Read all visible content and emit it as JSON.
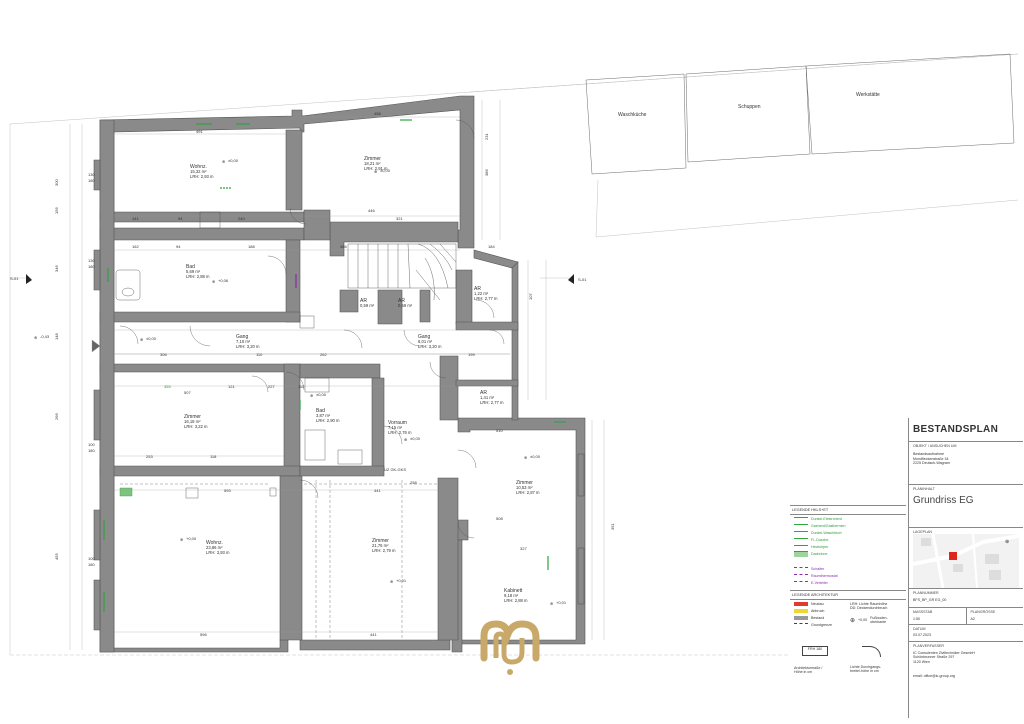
{
  "rooms": [
    {
      "name": "Wohnz.",
      "area": "15,32 m²",
      "lrh": "LRH: 2,93 m"
    },
    {
      "name": "Zimmer",
      "area": "18,21 m²",
      "lrh": "LRH: 2,91 m"
    },
    {
      "name": "Bad",
      "area": "5,69 m²",
      "lrh": "LRH: 2,88 m"
    },
    {
      "name": "Gang",
      "area": "7,10 m²",
      "lrh": "LRH: 3,20 m"
    },
    {
      "name": "AR",
      "area": "0,59 m²",
      "lrh": ""
    },
    {
      "name": "AR",
      "area": "0,59 m²",
      "lrh": ""
    },
    {
      "name": "Gang",
      "area": "6,01 m²",
      "lrh": "LRH: 3,20 m"
    },
    {
      "name": "AR",
      "area": "1,22 m²",
      "lrh": "LRH: 2,77 m"
    },
    {
      "name": "Zimmer",
      "area": "16,18 m²",
      "lrh": "LRH: 3,22 m"
    },
    {
      "name": "Bad",
      "area": "3,87 m²",
      "lrh": "LRH: 2,90 m"
    },
    {
      "name": "Vorraum",
      "area": "7,15 m²",
      "lrh": "LRH: 2,76 m"
    },
    {
      "name": "AR",
      "area": "1,41 m²",
      "lrh": "LRH: 2,77 m"
    },
    {
      "name": "Zimmer",
      "area": "10,53 m²",
      "lrh": "LRH: 2,87 m"
    },
    {
      "name": "Wohnz.",
      "area": "23,86 m²",
      "lrh": "LRH: 3,93 m"
    },
    {
      "name": "Zimmer",
      "area": "21,76 m²",
      "lrh": "LRH: 2,79 m"
    },
    {
      "name": "Kabinett",
      "area": "9,18 m²",
      "lrh": "LRH: 2,88 m"
    }
  ],
  "outbuildings": [
    "Waschküche",
    "Schuppen",
    "Werkstätte"
  ],
  "section_marks": {
    "left": "S-01",
    "right": "S-01"
  },
  "level_marks": [
    "-0,43",
    "±0,00",
    "±0,00",
    "±0,00",
    "±0,00",
    "±0,00",
    "±0,00",
    "+0,01",
    "+0,06",
    "+0,01",
    "+0,00"
  ],
  "window_tags": [
    "130",
    "180",
    "130",
    "180",
    "100",
    "180",
    "100",
    "180"
  ],
  "dims": {
    "top": [
      "491",
      "458"
    ],
    "mid": [
      "141",
      "94",
      "240",
      "446",
      "321"
    ],
    "row2": [
      "162",
      "94",
      "188",
      "466",
      "184"
    ],
    "corr": [
      "306",
      "110",
      "262",
      "199"
    ],
    "mid2": [
      "355",
      "507",
      "121",
      "227",
      "110",
      "510"
    ],
    "bottom1": [
      "253",
      "118",
      "593",
      "508",
      "441",
      "258",
      "327"
    ],
    "bottom2": [
      "596",
      "441"
    ],
    "vert_left": [
      "300",
      "156",
      "346",
      "148",
      "266",
      "455"
    ],
    "vert_right": [
      "231",
      "386",
      "107",
      "351"
    ]
  },
  "sw": "UZ GK-GKS",
  "title_block": {
    "title": "BESTANDSPLAN",
    "objekt_label": "OBJEKT / ANSUCHEN UM",
    "objekt_lines": [
      "Bestandsaufnahme",
      "Mondfleckenstraße 34",
      "2225 Deutsch-Wagram"
    ],
    "planinhalt_label": "PLANINHALT",
    "planinhalt": "Grundriss EG",
    "lageplan_label": "LAGEPLAN",
    "plannummer_label": "PLANNUMMER",
    "plannummer": "BFS_BP_GR EG_00",
    "massstab_label": "MASSSTAB",
    "massstab": "1:50",
    "plangroesse_label": "PLANGRÖSSE",
    "plangroesse": "A2",
    "datum_label": "DATUM",
    "datum": "03.07.2023",
    "planverfasser_label": "PLANVERFASSER",
    "planverfasser_lines": [
      "IC Consulenten Ziviltechniker GesmbH",
      "Schönbrunner Straße 297",
      "1120 Wien"
    ],
    "email": "email: office@ic-group.org"
  },
  "legend": {
    "hkls_head": "LEGENDE HKLS+ET",
    "hkls_items": [
      "Dunkel-Elektroherd",
      "Gasherd/Gasthermen",
      "Dunkel-Waschtisch",
      "Fl.-Dusche",
      "Heizkörper",
      "Dachrinne"
    ],
    "purple_items": [
      "Schalter",
      "Raumthermostat",
      "E-Verteiler"
    ],
    "arch_head": "LEGENDE ARCHITEKTUR",
    "arch_items": [
      "Neubau",
      "Abbruch",
      "Bestand",
      "Grundgrenze"
    ],
    "arch_colors": {
      "Neubau": "#e23a2a",
      "Abbruch": "#f1d630",
      "Bestand": "#9a9a9a"
    },
    "lrh_note": "LRH: Lichte Raumhöhe",
    "dd_note": "DD: Deckendurchbruch",
    "fb_note": "Fußboden-\noberkante",
    "fb_value": "+0,00",
    "frh_value": "FRH 180",
    "arch_note1": "Architekturmaße /",
    "arch_note2": "Höhe in cm",
    "licht_note1": "Lichte Durchgangs-",
    "licht_note2": "breite/-höhe in cm"
  },
  "colors": {
    "accent_green": "#2fa33c",
    "wall": "#8a8a8a",
    "logo": "#c9a96a"
  }
}
